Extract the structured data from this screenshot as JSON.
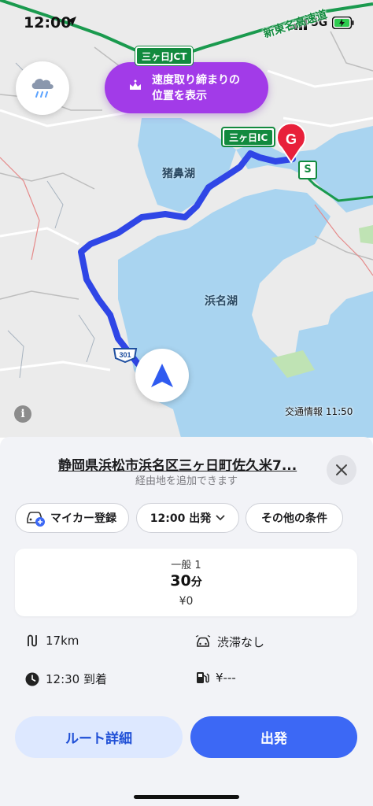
{
  "status_bar": {
    "time": "12:00",
    "network": "5G"
  },
  "map": {
    "speed_enforcement": {
      "line1": "速度取り締まりの",
      "line2": "位置を表示"
    },
    "labels": {
      "jct": "三ヶ日JCT",
      "ic": "三ヶ日IC",
      "expressway": "新東名高速道",
      "lake_inohana": "猪鼻湖",
      "lake_hamana": "浜名湖",
      "route_number": "301",
      "goal_marker": "G",
      "start_marker": "S"
    },
    "traffic_info": "交通情報 11:50",
    "info_glyph": "i",
    "colors": {
      "route": "#2f46e6",
      "water": "#a9d4f0",
      "land": "#e9e9e9",
      "goal_pin": "#e8203a",
      "highway": "#1a9a4e"
    }
  },
  "panel": {
    "destination": "静岡県浜松市浜名区三ヶ日町佐久米7...",
    "add_waypoint": "経由地を追加できます",
    "chips": {
      "car": "マイカー登録",
      "departure": "12:00 出発",
      "more": "その他の条件"
    },
    "route": {
      "type": "一般 1",
      "duration_value": "30",
      "duration_unit": "分",
      "toll": "¥0"
    },
    "stats": {
      "distance": "17km",
      "traffic": "渋滞なし",
      "arrival": "12:30 到着",
      "fuel": "¥---"
    },
    "buttons": {
      "detail": "ルート詳細",
      "go": "出発"
    }
  }
}
